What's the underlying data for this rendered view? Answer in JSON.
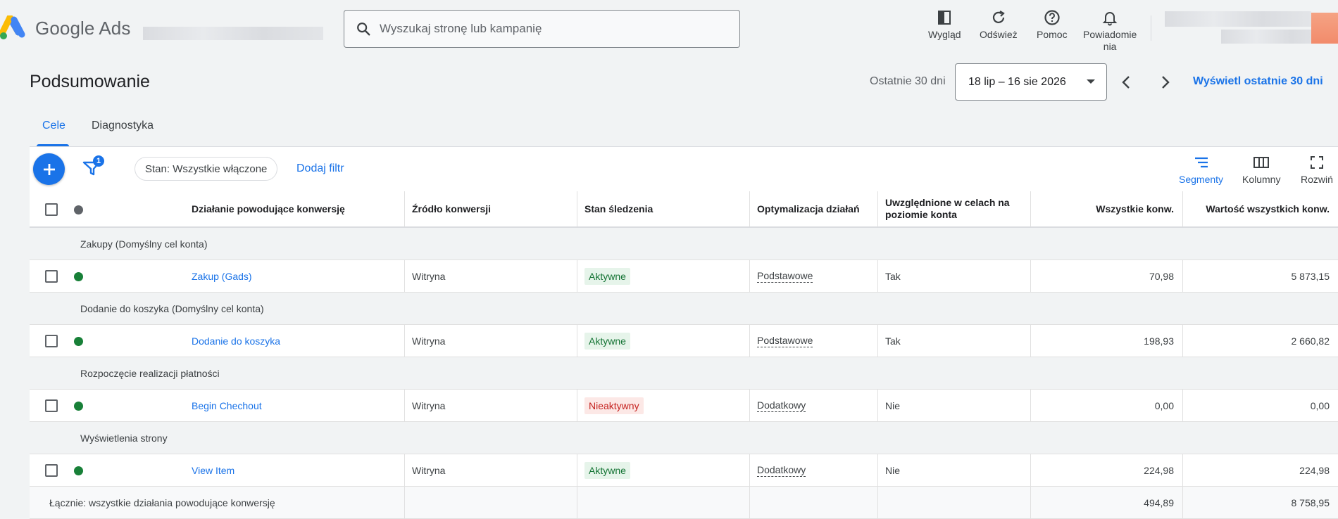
{
  "app": {
    "product_name": "Google Ads",
    "search_placeholder": "Wyszukaj stronę lub kampanię"
  },
  "top_tools": [
    {
      "label": "Wygląd",
      "icon": "appearance-icon"
    },
    {
      "label": "Odśwież",
      "icon": "refresh-icon"
    },
    {
      "label": "Pomoc",
      "icon": "help-icon"
    },
    {
      "label_line1": "Powiadomie",
      "label_line2": "nia",
      "icon": "bell-icon"
    }
  ],
  "page": {
    "title": "Podsumowanie",
    "range_label": "Ostatnie 30 dni",
    "date_range": "18 lip – 16 sie 2026",
    "view_last": "Wyświetl ostatnie 30 dni"
  },
  "tabs": [
    {
      "label": "Cele",
      "active": true
    },
    {
      "label": "Diagnostyka",
      "active": false
    }
  ],
  "toolbar": {
    "filter_count": "1",
    "status_chip": "Stan: Wszystkie włączone",
    "add_filter": "Dodaj filtr",
    "segments": "Segmenty",
    "columns": "Kolumny",
    "expand": "Rozwiń"
  },
  "table": {
    "headers": {
      "action": "Działanie powodujące konwersję",
      "source": "Źródło konwersji",
      "tracking": "Stan śledzenia",
      "optimization": "Optymalizacja działań",
      "included_line1": "Uwzględnione w celach na",
      "included_line2": "poziomie konta",
      "all_conv": "Wszystkie konw.",
      "all_conv_value": "Wartość wszystkich konw."
    },
    "groups": [
      {
        "title": "Zakupy (Domyślny cel konta)",
        "row": {
          "name": "Zakup (Gads)",
          "source": "Witryna",
          "status": "Aktywne",
          "status_type": "on",
          "optimization": "Podstawowe",
          "included": "Tak",
          "all_conv": "70,98",
          "value": "5 873,15"
        }
      },
      {
        "title": "Dodanie do koszyka (Domyślny cel konta)",
        "row": {
          "name": "Dodanie do koszyka",
          "source": "Witryna",
          "status": "Aktywne",
          "status_type": "on",
          "optimization": "Podstawowe",
          "included": "Tak",
          "all_conv": "198,93",
          "value": "2 660,82"
        }
      },
      {
        "title": "Rozpoczęcie realizacji płatności",
        "row": {
          "name": "Begin Chechout",
          "source": "Witryna",
          "status": "Nieaktywny",
          "status_type": "off",
          "optimization": "Dodatkowy",
          "included": "Nie",
          "all_conv": "0,00",
          "value": "0,00"
        }
      },
      {
        "title": "Wyświetlenia strony",
        "row": {
          "name": "View Item",
          "source": "Witryna",
          "status": "Aktywne",
          "status_type": "on",
          "optimization": "Dodatkowy",
          "included": "Nie",
          "all_conv": "224,98",
          "value": "224,98"
        }
      }
    ],
    "total": {
      "label": "Łącznie: wszystkie działania powodujące konwersję",
      "all_conv": "494,89",
      "value": "8 758,95"
    }
  },
  "colors": {
    "accent": "#1a73e8",
    "active_green": "#188038",
    "inactive_red": "#c5221f"
  }
}
